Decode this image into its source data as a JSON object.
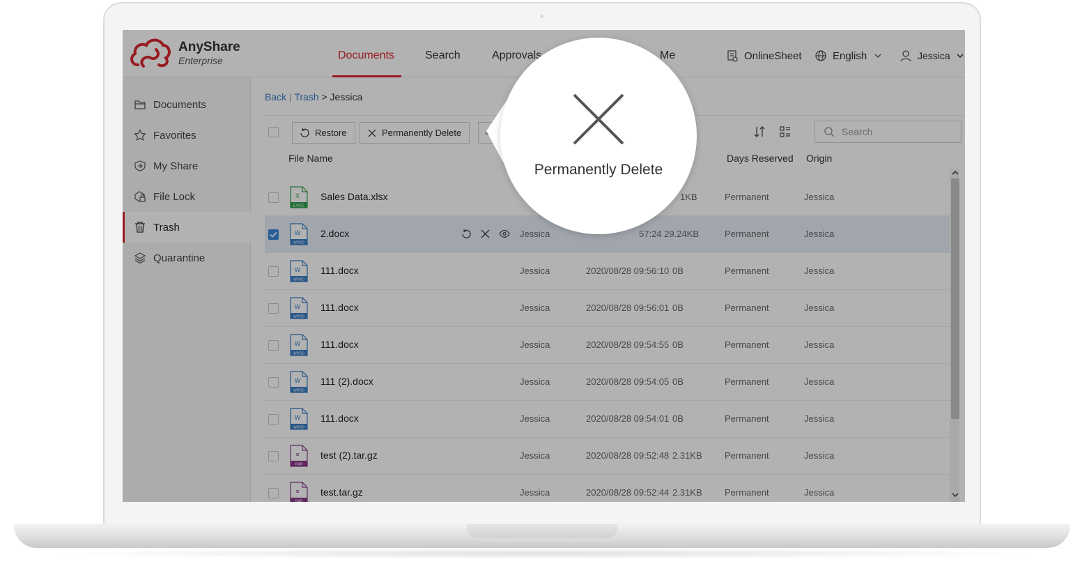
{
  "brand": {
    "name": "AnyShare",
    "sub": "Enterprise",
    "accent": "#d7282f",
    "link": "#3a78c3"
  },
  "nav": {
    "documents": "Documents",
    "search": "Search",
    "approvals": "Approvals",
    "me": "Me"
  },
  "header": {
    "online_sheet": "OnlineSheet",
    "language": "English",
    "user": "Jessica"
  },
  "sidebar": {
    "items": [
      {
        "label": "Documents",
        "icon": "folder-icon"
      },
      {
        "label": "Favorites",
        "icon": "star-icon"
      },
      {
        "label": "My Share",
        "icon": "share-icon"
      },
      {
        "label": "File Lock",
        "icon": "lock-icon"
      },
      {
        "label": "Trash",
        "icon": "trash-icon",
        "active": true
      },
      {
        "label": "Quarantine",
        "icon": "layers-icon"
      }
    ]
  },
  "breadcrumb": {
    "back": "Back",
    "sep": "|",
    "trash": "Trash",
    "arrow": ">",
    "current": "Jessica"
  },
  "toolbar": {
    "restore": "Restore",
    "delete": "Permanently Delete",
    "search_placeholder": "Search"
  },
  "table": {
    "columns": {
      "name": "File Name",
      "days": "Days Reserved",
      "origin": "Origin"
    },
    "rows": [
      {
        "name": "Sales Data.xlsx",
        "type": "excel",
        "badge": "EXCEL",
        "glyph": "X",
        "owner": "",
        "date": "",
        "size": "1KB",
        "days": "Permanent",
        "origin": "Jessica"
      },
      {
        "name": "2.docx",
        "type": "word",
        "badge": "WORD",
        "glyph": "W",
        "owner": "Jessica",
        "date": "",
        "size": "57:24 29.24KB",
        "days": "Permanent",
        "origin": "Jessica",
        "selected": true
      },
      {
        "name": "111.docx",
        "type": "word",
        "badge": "WORD",
        "glyph": "W",
        "owner": "Jessica",
        "date": "2020/08/28 09:56:10",
        "size": "0B",
        "days": "Permanent",
        "origin": "Jessica"
      },
      {
        "name": "111.docx",
        "type": "word",
        "badge": "WORD",
        "glyph": "W",
        "owner": "Jessica",
        "date": "2020/08/28 09:56:01",
        "size": "0B",
        "days": "Permanent",
        "origin": "Jessica"
      },
      {
        "name": "111.docx",
        "type": "word",
        "badge": "WORD",
        "glyph": "W",
        "owner": "Jessica",
        "date": "2020/08/28 09:54:55",
        "size": "0B",
        "days": "Permanent",
        "origin": "Jessica"
      },
      {
        "name": "111 (2).docx",
        "type": "word",
        "badge": "WORD",
        "glyph": "W",
        "owner": "Jessica",
        "date": "2020/08/28 09:54:05",
        "size": "0B",
        "days": "Permanent",
        "origin": "Jessica"
      },
      {
        "name": "111.docx",
        "type": "word",
        "badge": "WORD",
        "glyph": "W",
        "owner": "Jessica",
        "date": "2020/08/28 09:54:01",
        "size": "0B",
        "days": "Permanent",
        "origin": "Jessica"
      },
      {
        "name": "test (2).tar.gz",
        "type": "rar",
        "badge": "RAR",
        "glyph": "≡",
        "owner": "Jessica",
        "date": "2020/08/28 09:52:48",
        "size": "2.31KB",
        "days": "Permanent",
        "origin": "Jessica"
      },
      {
        "name": "test.tar.gz",
        "type": "rar",
        "badge": "RAR",
        "glyph": "≡",
        "owner": "Jessica",
        "date": "2020/08/28 09:52:44",
        "size": "2.31KB",
        "days": "Permanent",
        "origin": "Jessica"
      }
    ]
  },
  "callout": {
    "label": "Permanently Delete",
    "icon": "close-icon"
  },
  "colors": {
    "excel": "#2e9e4f",
    "word": "#3b7dc4",
    "rar": "#8a3a8a",
    "selected_row": "#e7eef8",
    "checkbox_on": "#3a86d8"
  }
}
